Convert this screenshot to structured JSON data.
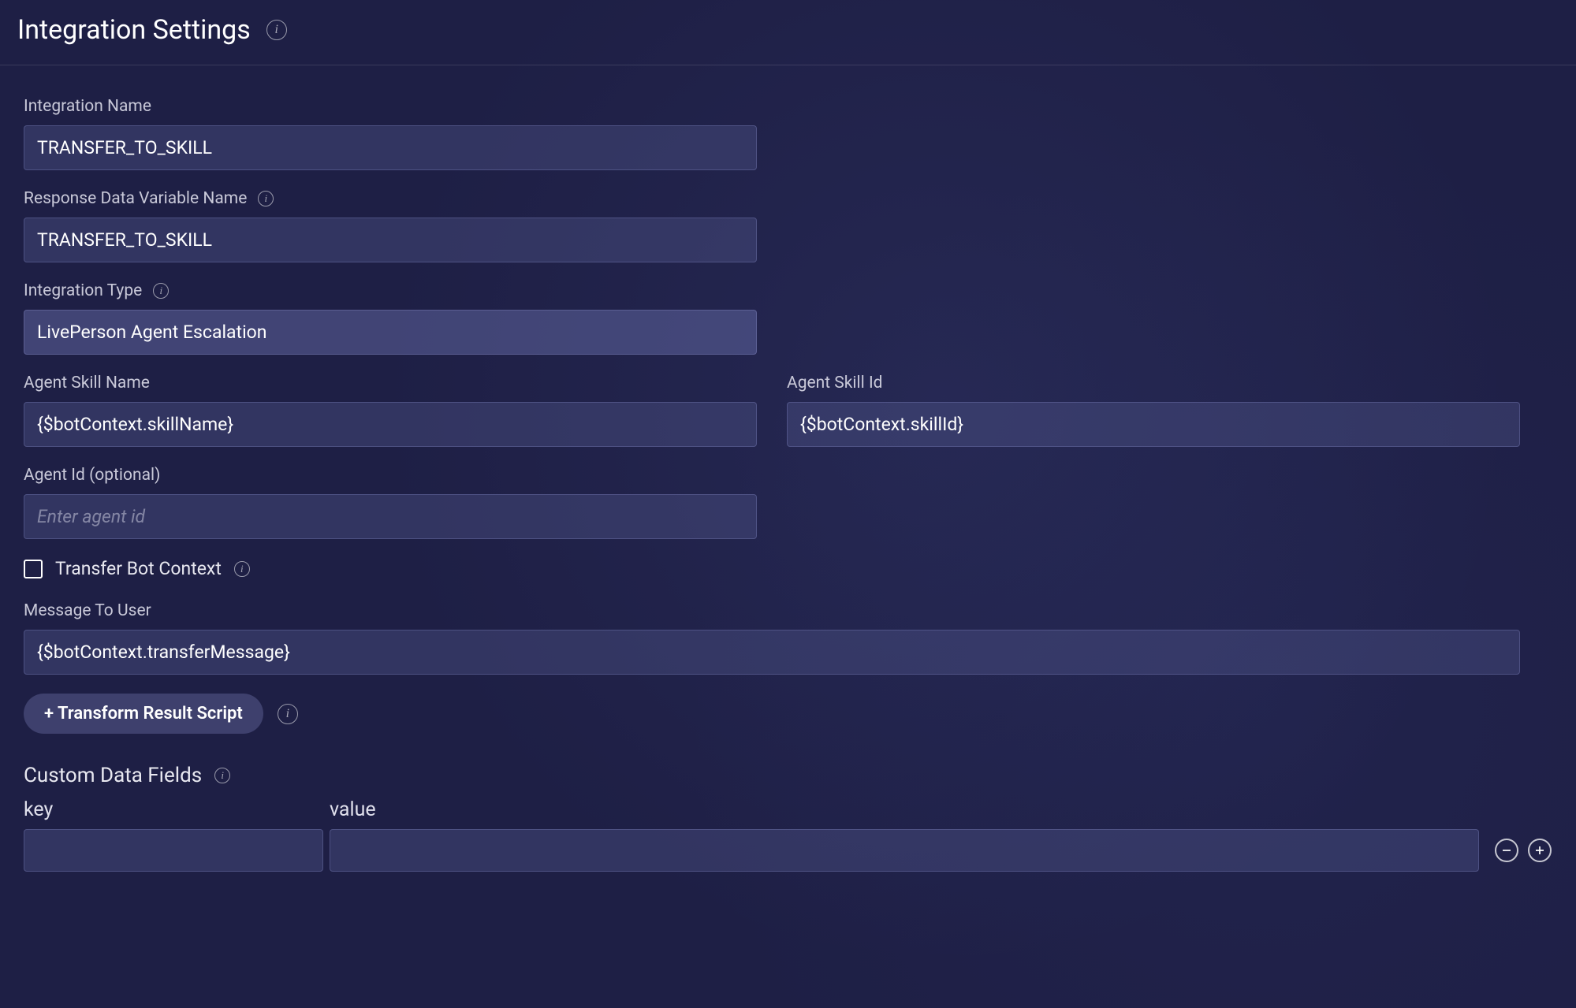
{
  "header": {
    "title": "Integration Settings"
  },
  "fields": {
    "integration_name": {
      "label": "Integration Name",
      "value": "TRANSFER_TO_SKILL"
    },
    "response_data_variable_name": {
      "label": "Response Data Variable Name",
      "value": "TRANSFER_TO_SKILL"
    },
    "integration_type": {
      "label": "Integration Type",
      "value": "LivePerson Agent Escalation"
    },
    "agent_skill_name": {
      "label": "Agent Skill Name",
      "value": "{$botContext.skillName}"
    },
    "agent_skill_id": {
      "label": "Agent Skill Id",
      "value": "{$botContext.skillId}"
    },
    "agent_id": {
      "label": "Agent Id (optional)",
      "value": "",
      "placeholder": "Enter agent id"
    },
    "transfer_bot_context": {
      "label": "Transfer Bot Context",
      "checked": false
    },
    "message_to_user": {
      "label": "Message To User",
      "value": "{$botContext.transferMessage}"
    }
  },
  "buttons": {
    "transform_result_script": "+ Transform Result Script"
  },
  "custom_data_fields": {
    "title": "Custom Data Fields",
    "key_header": "key",
    "value_header": "value",
    "rows": [
      {
        "key": "",
        "value": ""
      }
    ]
  }
}
